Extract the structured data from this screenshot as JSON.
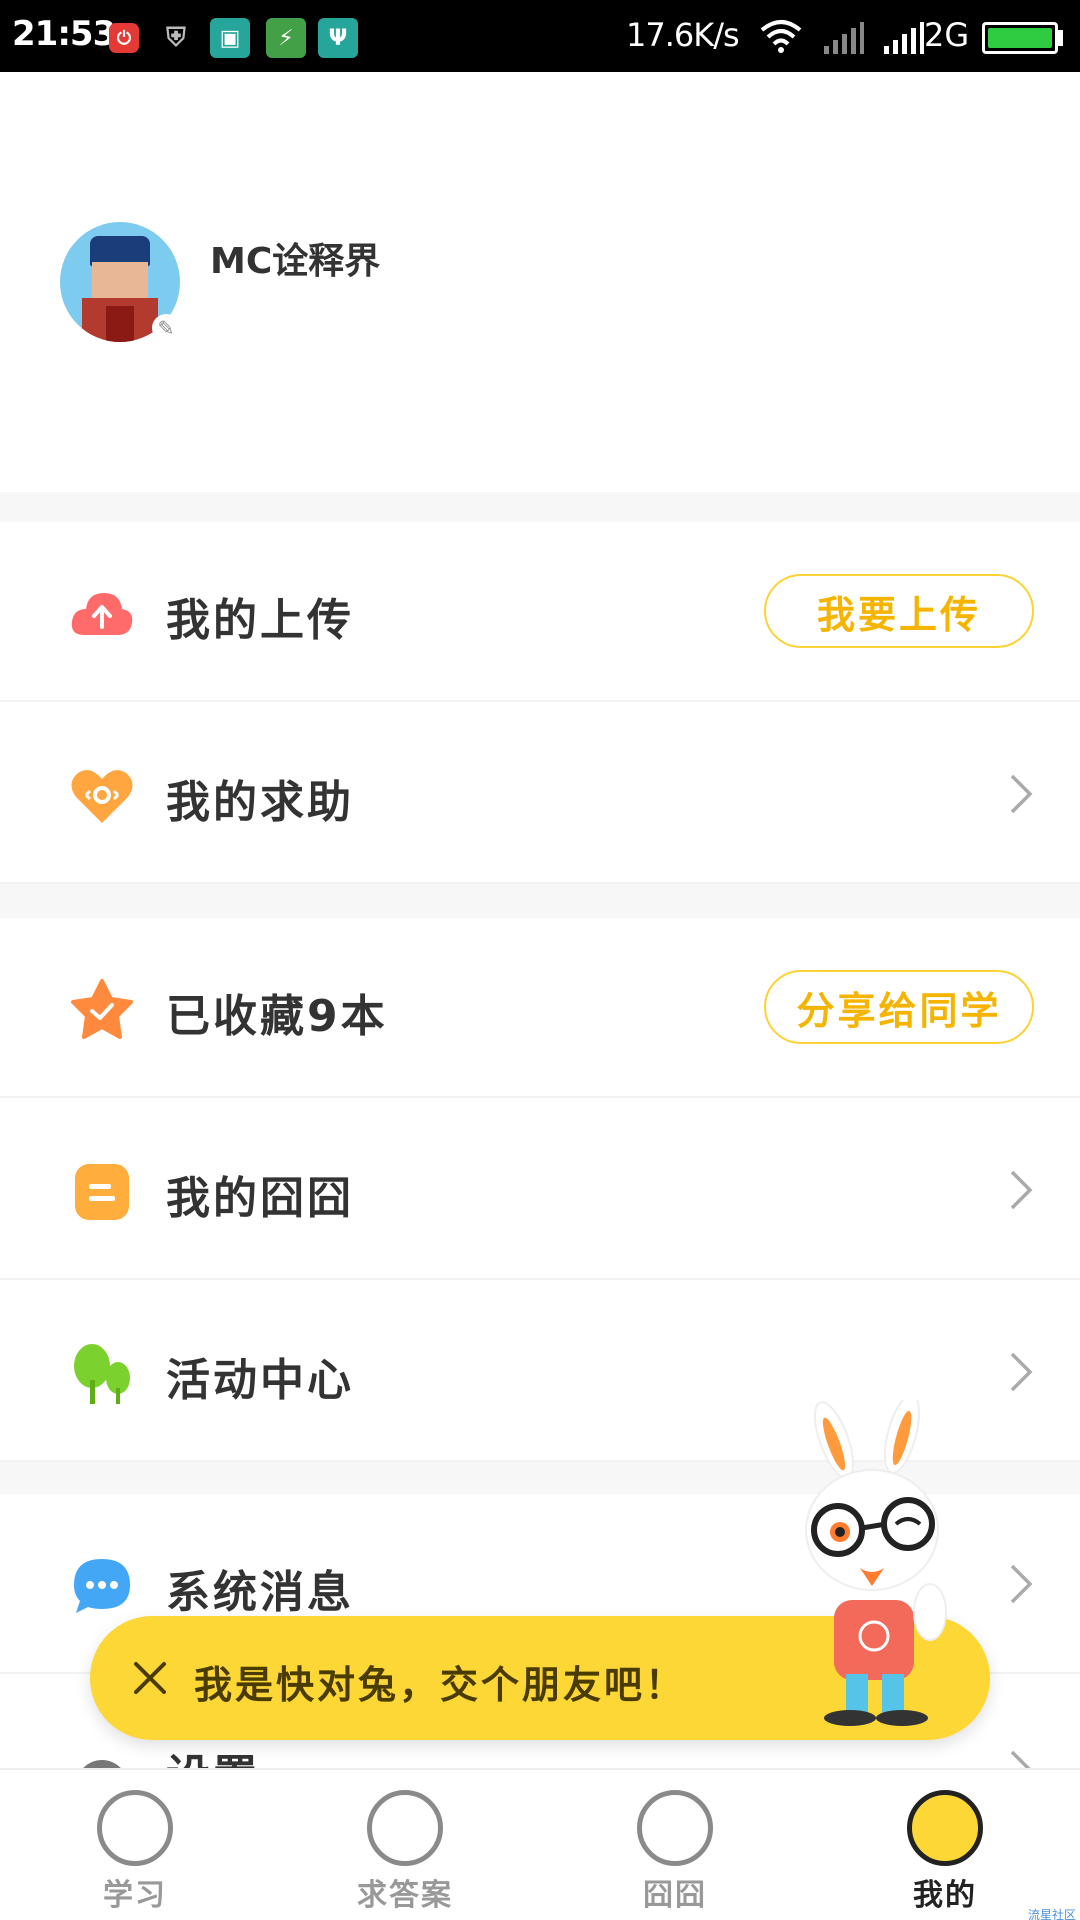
{
  "status_bar": {
    "time": "21:53",
    "net_speed": "17.6K/s",
    "network_type": "2G",
    "icons": [
      "alarm-app-icon",
      "shield-icon",
      "screenshot-icon",
      "battery-app-icon",
      "usb-icon",
      "wifi-icon",
      "signal-icon",
      "signal-icon",
      "battery-icon"
    ]
  },
  "profile": {
    "username": "MC诠释界",
    "avatar": "avatar",
    "edit": "pencil-icon"
  },
  "menu": {
    "upload": {
      "label": "我的上传",
      "button": "我要上传",
      "icon": "cloud-upload-icon",
      "color": "#ff6b6b"
    },
    "help": {
      "label": "我的求助",
      "icon": "heart-eye-icon",
      "color": "#ffa640"
    },
    "favorites": {
      "label": "已收藏9本",
      "button": "分享给同学",
      "icon": "star-check-icon",
      "color": "#ff8a3d"
    },
    "jiongjiong": {
      "label": "我的囧囧",
      "icon": "note-icon",
      "color": "#ffae3d"
    },
    "activity": {
      "label": "活动中心",
      "icon": "trees-icon",
      "color": "#7bd12e"
    },
    "messages": {
      "label": "系统消息",
      "icon": "chat-bubble-icon",
      "color": "#43a7f5"
    },
    "settings": {
      "label": "设置",
      "icon": "gear-icon"
    }
  },
  "toast": {
    "message": "我是快对兔，交个朋友吧！"
  },
  "nav": {
    "items": [
      {
        "label": "学习",
        "icon": "lightbulb-icon"
      },
      {
        "label": "求答案",
        "icon": "target-icon"
      },
      {
        "label": "囧囧",
        "icon": "carrot-icon"
      },
      {
        "label": "我的",
        "icon": "rabbit-icon"
      }
    ],
    "active_index": 3
  },
  "watermark": "流星社区",
  "colors": {
    "accent_yellow": "#fcd736",
    "pill_text": "#f5b400",
    "status_bar_bg": "#000000"
  }
}
